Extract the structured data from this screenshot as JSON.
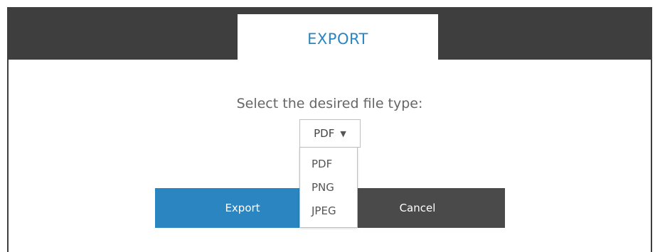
{
  "dialog": {
    "tab_title": "EXPORT",
    "prompt": "Select the desired file type:"
  },
  "file_type_select": {
    "selected": "PDF",
    "arrow_glyph": "▼",
    "options": [
      "PDF",
      "PNG",
      "JPEG"
    ]
  },
  "buttons": {
    "export_label": "Export",
    "cancel_label": "Cancel"
  },
  "colors": {
    "accent": "#2b85c0",
    "header_dark": "#3e3e3e",
    "cancel_button": "#4a4a4a"
  }
}
